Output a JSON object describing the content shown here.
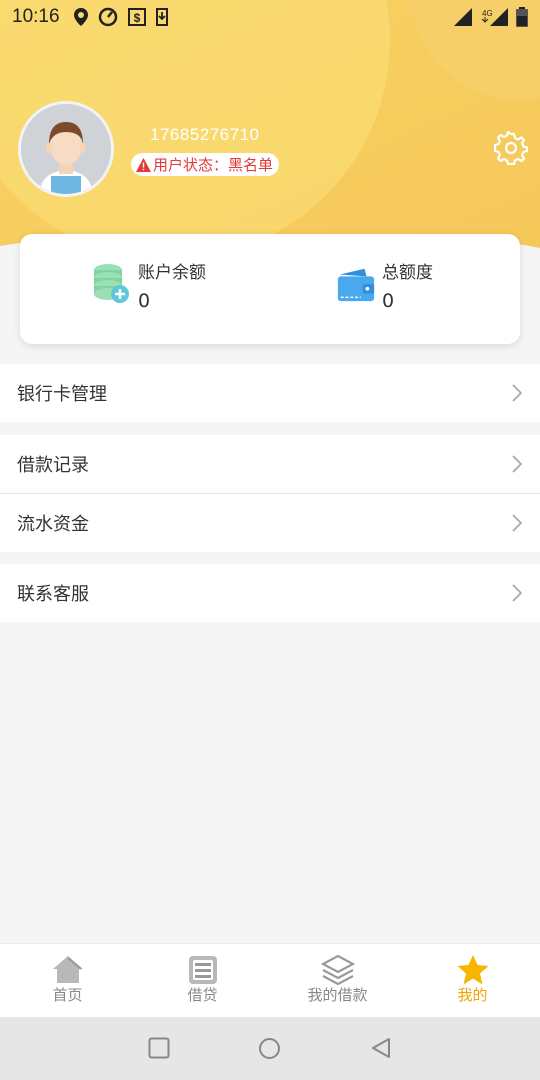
{
  "status_bar": {
    "time": "10:16",
    "left_icons": [
      "location-icon",
      "speed-icon",
      "money-icon",
      "download-icon"
    ],
    "right_icons": [
      "signal-icon",
      "4g-signal-icon",
      "battery-icon"
    ],
    "network_label": "4G"
  },
  "profile": {
    "phone": "17685276710",
    "status_text": "用户状态：黑名单",
    "avatar_icon": "avatar-icon",
    "settings_icon": "gear-icon"
  },
  "balance": {
    "account": {
      "label": "账户余额",
      "value": "0",
      "icon": "coins-icon"
    },
    "total": {
      "label": "总额度",
      "value": "0",
      "icon": "wallet-icon"
    }
  },
  "menu": [
    {
      "label": "银行卡管理"
    },
    {
      "label": "借款记录"
    },
    {
      "label": "流水资金"
    },
    {
      "label": "联系客服"
    }
  ],
  "bottom_nav": [
    {
      "label": "首页",
      "icon": "home-icon",
      "active": false
    },
    {
      "label": "借贷",
      "icon": "document-icon",
      "active": false
    },
    {
      "label": "我的借款",
      "icon": "layers-icon",
      "active": false
    },
    {
      "label": "我的",
      "icon": "star-icon",
      "active": true
    }
  ],
  "colors": {
    "header_yellow": "#f6cb5a",
    "header_light": "#fbe07a",
    "accent": "#f0a500",
    "danger": "#e23a3a"
  }
}
